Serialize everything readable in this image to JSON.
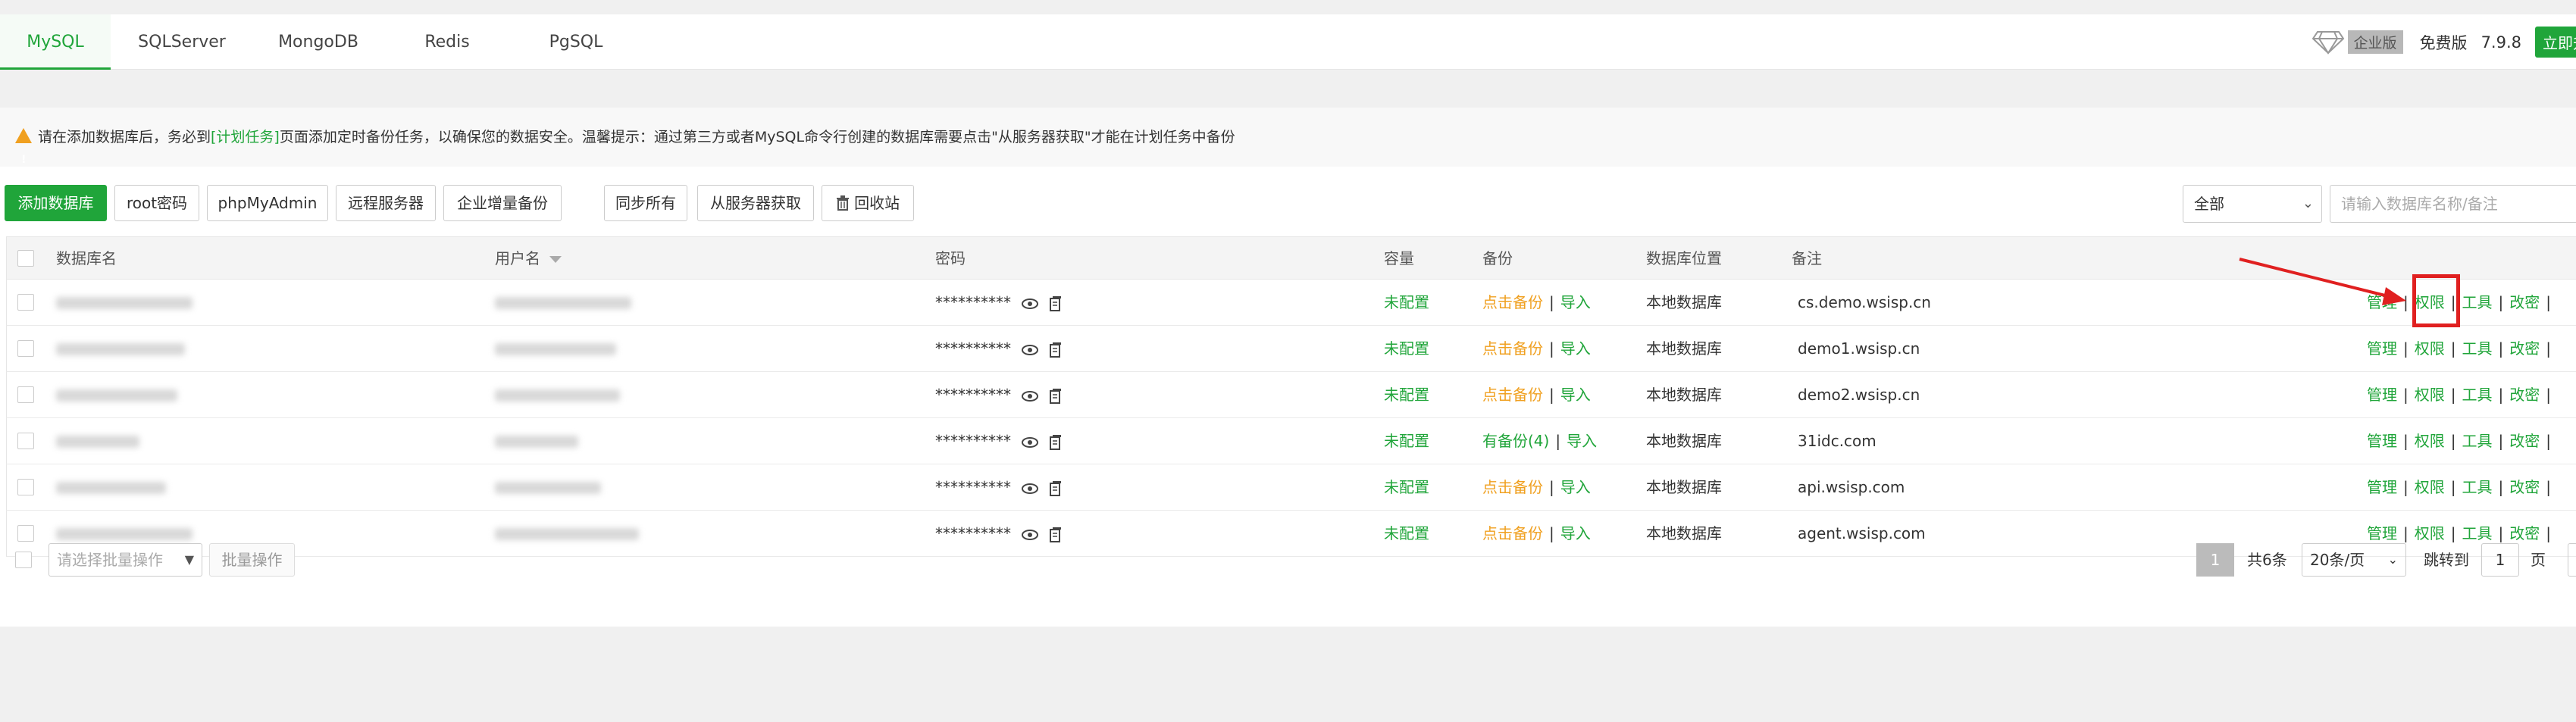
{
  "tabs": [
    {
      "label": "MySQL",
      "active": true
    },
    {
      "label": "SQLServer",
      "active": false
    },
    {
      "label": "MongoDB",
      "active": false
    },
    {
      "label": "Redis",
      "active": false
    },
    {
      "label": "PgSQL",
      "active": false
    }
  ],
  "version": {
    "enterprise_label": "企业版",
    "free_label": "免费版",
    "version_number": "7.9.8",
    "upgrade_label": "立即升级"
  },
  "notice": {
    "prefix": "请在添加数据库后，务必到",
    "link_text": "[计划任务]",
    "suffix": "页面添加定时备份任务，以确保您的数据安全。温馨提示：通过第三方或者MySQL命令行创建的数据库需要点击\"从服务器获取\"才能在计划任务中备份"
  },
  "toolbar": {
    "add_db": "添加数据库",
    "root_pwd": "root密码",
    "phpmyadmin": "phpMyAdmin",
    "remote_server": "远程服务器",
    "enterprise_backup": "企业增量备份",
    "sync_all": "同步所有",
    "fetch_from_server": "从服务器获取",
    "recycle_bin": "回收站",
    "filter_value": "全部",
    "search_placeholder": "请输入数据库名称/备注"
  },
  "table": {
    "headers": {
      "name": "数据库名",
      "user": "用户名",
      "password": "密码",
      "capacity": "容量",
      "backup": "备份",
      "location": "数据库位置",
      "remark": "备注"
    },
    "rows": [
      {
        "password": "**********",
        "capacity": "未配置",
        "backup": "点击备份",
        "import": "导入",
        "location": "本地数据库",
        "remark": "cs.demo.wsisp.cn",
        "has_backup": false
      },
      {
        "password": "**********",
        "capacity": "未配置",
        "backup": "点击备份",
        "import": "导入",
        "location": "本地数据库",
        "remark": "demo1.wsisp.cn",
        "has_backup": false
      },
      {
        "password": "**********",
        "capacity": "未配置",
        "backup": "点击备份",
        "import": "导入",
        "location": "本地数据库",
        "remark": "demo2.wsisp.cn",
        "has_backup": false
      },
      {
        "password": "**********",
        "capacity": "未配置",
        "backup": "有备份(4)",
        "import": "导入",
        "location": "本地数据库",
        "remark": "31idc.com",
        "has_backup": true
      },
      {
        "password": "**********",
        "capacity": "未配置",
        "backup": "点击备份",
        "import": "导入",
        "location": "本地数据库",
        "remark": "api.wsisp.com",
        "has_backup": false
      },
      {
        "password": "**********",
        "capacity": "未配置",
        "backup": "点击备份",
        "import": "导入",
        "location": "本地数据库",
        "remark": "agent.wsisp.com",
        "has_backup": false
      }
    ],
    "actions": {
      "manage": "管理",
      "permission": "权限",
      "tools": "工具",
      "change_pwd": "改密"
    }
  },
  "footer": {
    "batch_placeholder": "请选择批量操作",
    "batch_button": "批量操作",
    "current_page": "1",
    "total": "共6条",
    "page_size": "20条/页",
    "jump_label": "跳转到",
    "jump_value": "1",
    "page_unit": "页"
  },
  "colors": {
    "accent": "#20a53a",
    "warning": "#f0a020",
    "highlight": "#e02020"
  }
}
